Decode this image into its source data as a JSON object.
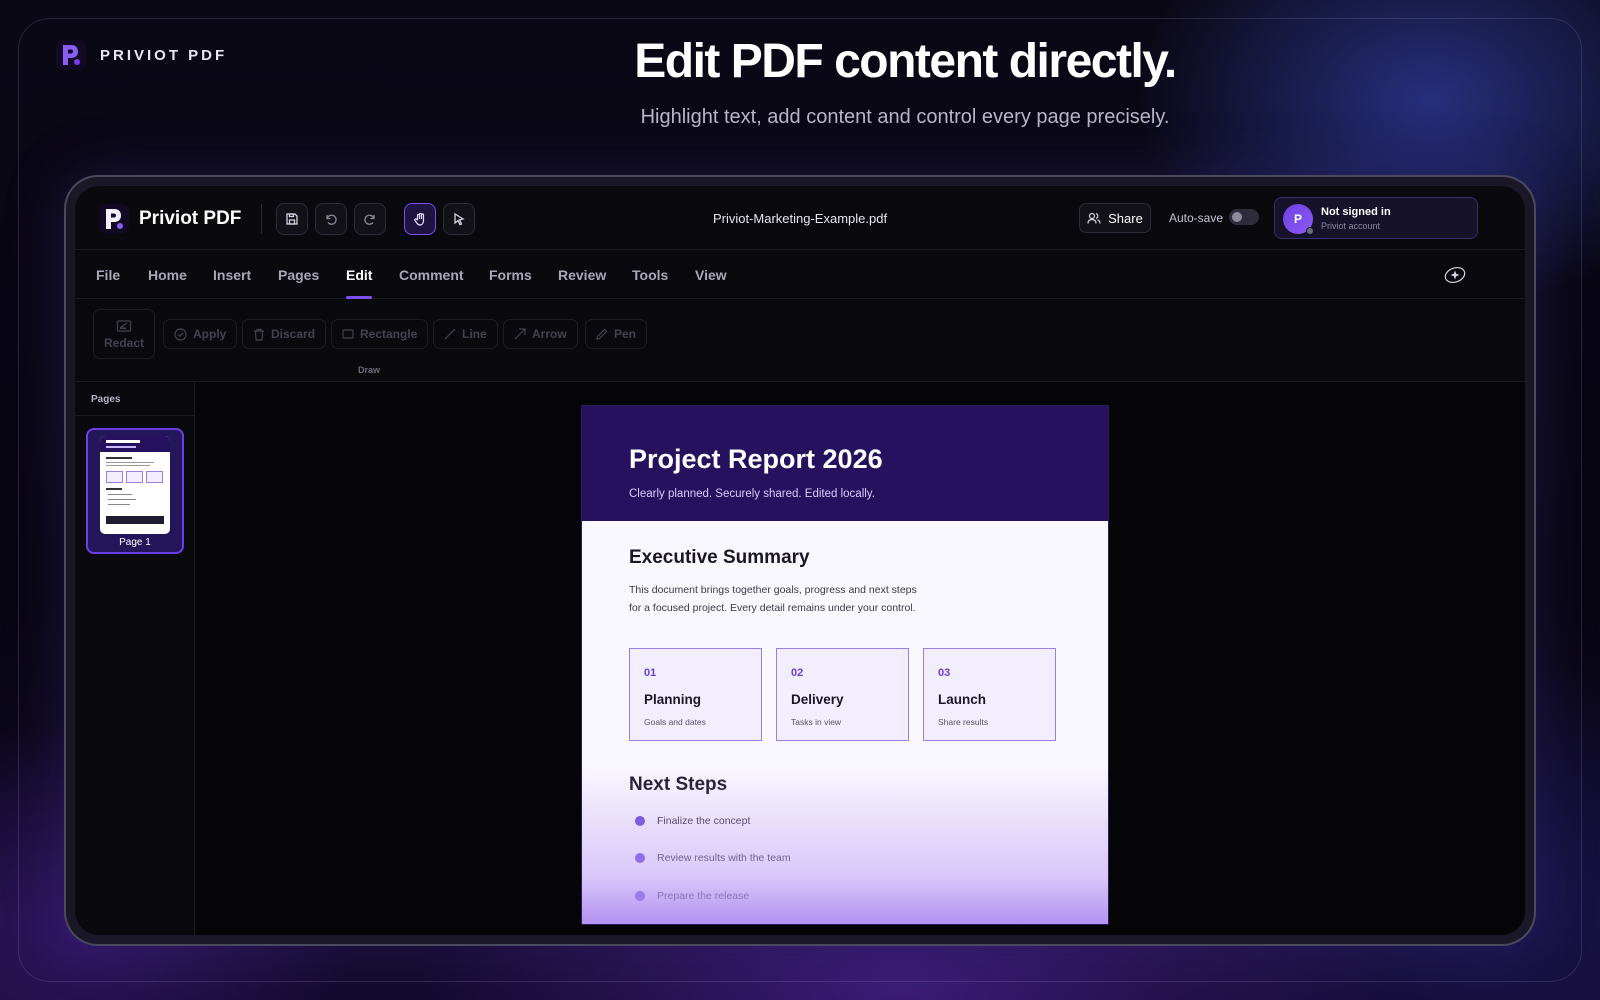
{
  "brand": {
    "name": "PRIVIOT PDF"
  },
  "hero": {
    "title": "Edit PDF content directly.",
    "subtitle": "Highlight text, add content and control every page precisely."
  },
  "app": {
    "name": "Priviot PDF",
    "filename": "Priviot-Marketing-Example.pdf",
    "share_label": "Share",
    "autosave_label": "Auto-save",
    "autosave_on": false,
    "account": {
      "avatar_letter": "P",
      "title": "Not signed in",
      "subtitle": "Priviot account"
    }
  },
  "toolbar_icons": [
    "save-icon",
    "undo-icon",
    "redo-icon",
    "hand-icon",
    "cursor-icon"
  ],
  "menu": {
    "items": [
      {
        "label": "File"
      },
      {
        "label": "Home"
      },
      {
        "label": "Insert"
      },
      {
        "label": "Pages"
      },
      {
        "label": "Edit"
      },
      {
        "label": "Comment"
      },
      {
        "label": "Forms"
      },
      {
        "label": "Review"
      },
      {
        "label": "Tools"
      },
      {
        "label": "View"
      }
    ],
    "active": "Edit"
  },
  "ribbon": {
    "redact": "Redact",
    "buttons": [
      {
        "label": "Apply",
        "icon": "check-circle-icon"
      },
      {
        "label": "Discard",
        "icon": "trash-icon"
      },
      {
        "label": "Rectangle",
        "icon": "rectangle-icon"
      },
      {
        "label": "Line",
        "icon": "line-icon"
      },
      {
        "label": "Arrow",
        "icon": "arrow-icon"
      },
      {
        "label": "Pen",
        "icon": "pen-icon"
      }
    ],
    "group_label": "Draw"
  },
  "sidebar": {
    "header": "Pages",
    "pages": [
      {
        "label": "Page 1"
      }
    ]
  },
  "document": {
    "title": "Project Report 2026",
    "subtitle": "Clearly planned. Securely shared. Edited locally.",
    "summary_title": "Executive Summary",
    "summary_line1": "This document brings together goals, progress and next steps",
    "summary_line2": "for a focused project. Every detail remains under your control.",
    "cards": [
      {
        "num": "01",
        "title": "Planning",
        "sub": "Goals and dates"
      },
      {
        "num": "02",
        "title": "Delivery",
        "sub": "Tasks in view"
      },
      {
        "num": "03",
        "title": "Launch",
        "sub": "Share results"
      }
    ],
    "next_title": "Next Steps",
    "steps": [
      "Finalize the concept",
      "Review results with the team",
      "Prepare the release"
    ]
  },
  "colors": {
    "accent": "#7b4ff0",
    "header_bg": "#26115e",
    "card_border": "#9a7fe6"
  }
}
